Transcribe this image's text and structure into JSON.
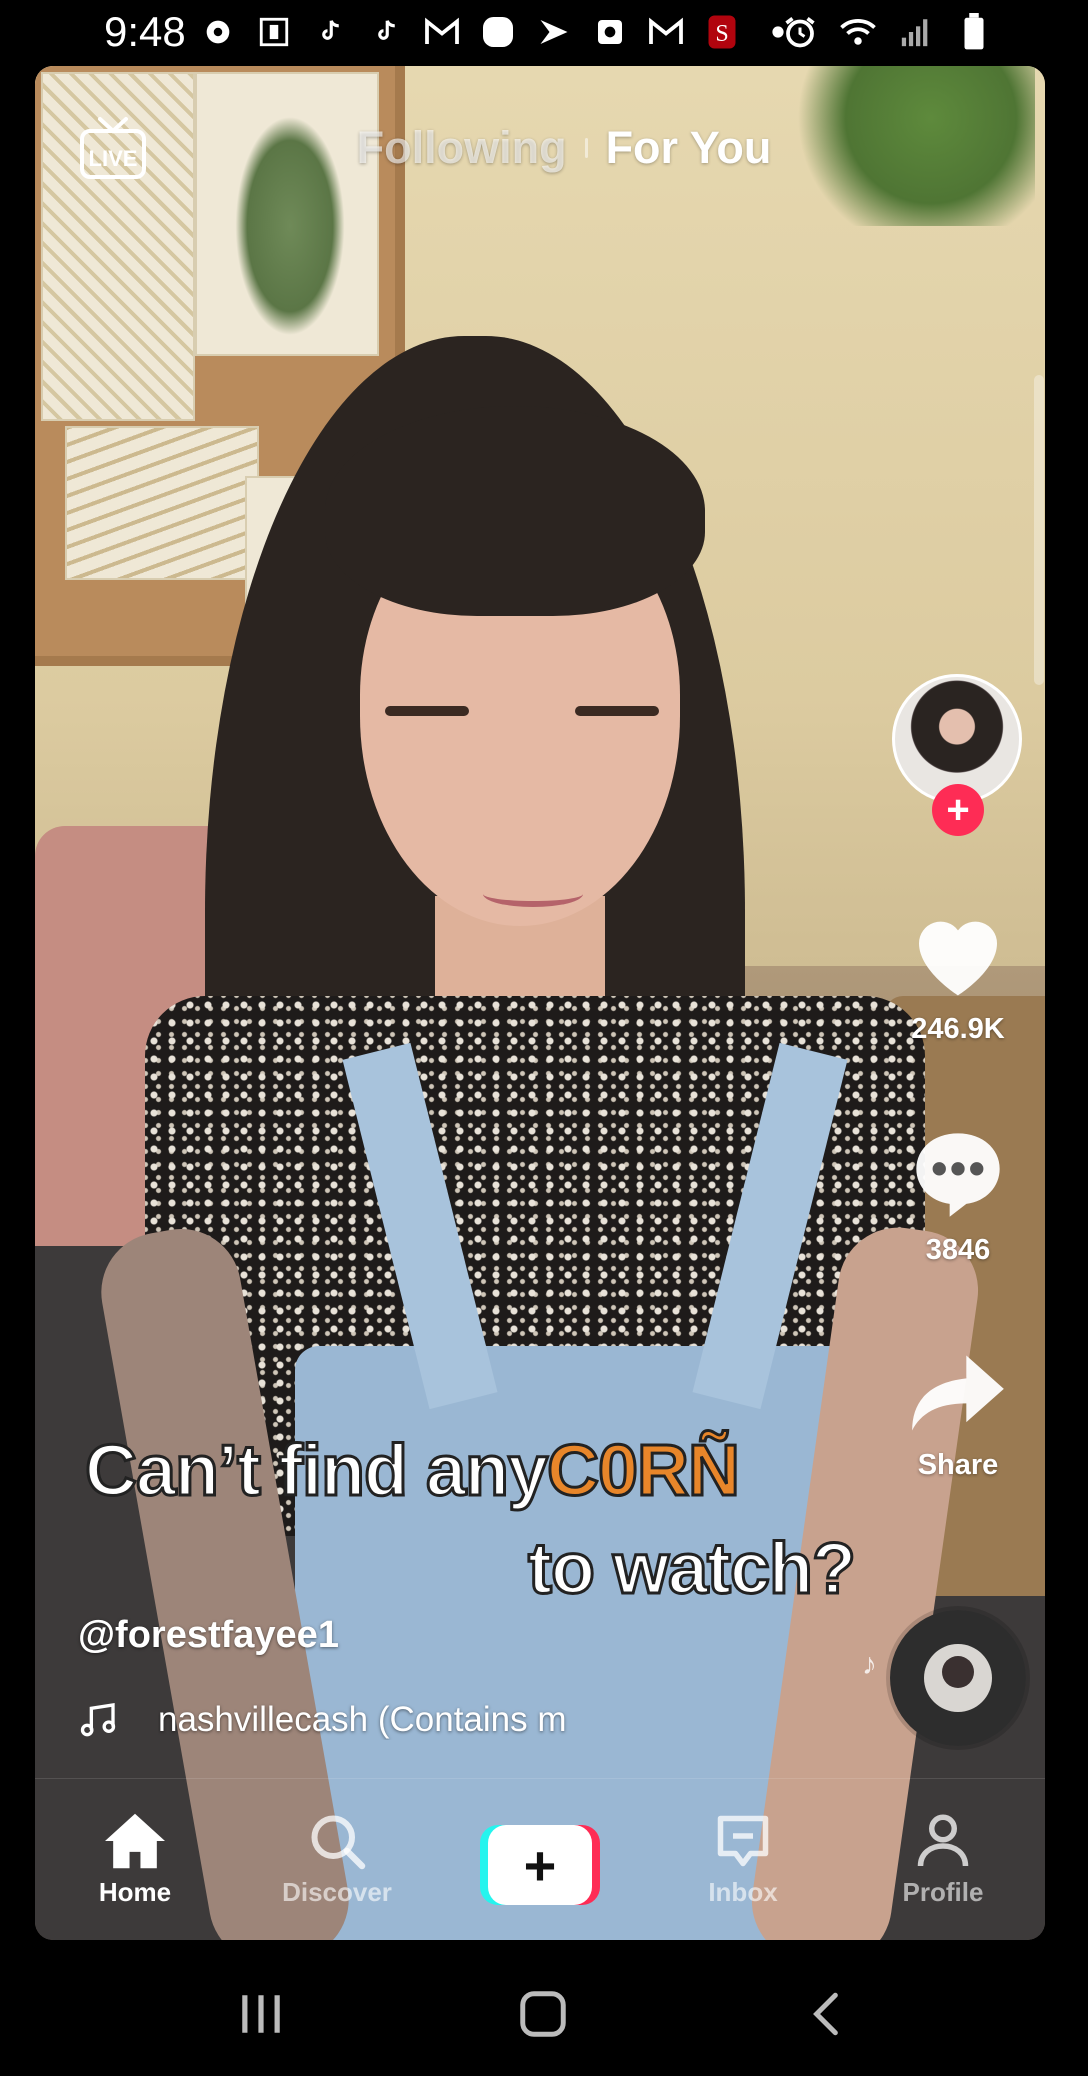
{
  "status_bar": {
    "time": "9:48",
    "left_icons": [
      "settings-icon",
      "badge-icon",
      "tiktok-icon",
      "tiktok-icon",
      "gmail-icon",
      "chat-icon",
      "sprint-icon",
      "screenshot-icon",
      "gmail-icon",
      "stanford-icon",
      "dot-icon"
    ],
    "right_icons": [
      "alarm-icon",
      "wifi-icon",
      "signal-icon",
      "battery-icon"
    ]
  },
  "top_nav": {
    "live_label": "LIVE",
    "tabs": [
      {
        "label": "Following",
        "active": false
      },
      {
        "label": "For You",
        "active": true
      }
    ]
  },
  "right_rail": {
    "follow_symbol": "+",
    "likes": "246.9K",
    "comments": "3846",
    "share_label": "Share"
  },
  "video_overlay": {
    "line1_prefix": "Can’t find any",
    "line1_highlight": "C0RÑ",
    "line2": "to watch?"
  },
  "post": {
    "username": "@forestfayee1",
    "sound": "nashvillecash (Contains m"
  },
  "bottom_nav": {
    "items": [
      {
        "label": "Home",
        "active": true
      },
      {
        "label": "Discover",
        "active": false
      },
      {
        "label": "Inbox",
        "active": false
      },
      {
        "label": "Profile",
        "active": false
      }
    ],
    "create_symbol": "+"
  },
  "colors": {
    "accent_red": "#fe2c55",
    "accent_cyan": "#25f4ee",
    "highlight_orange": "#e8862a"
  }
}
